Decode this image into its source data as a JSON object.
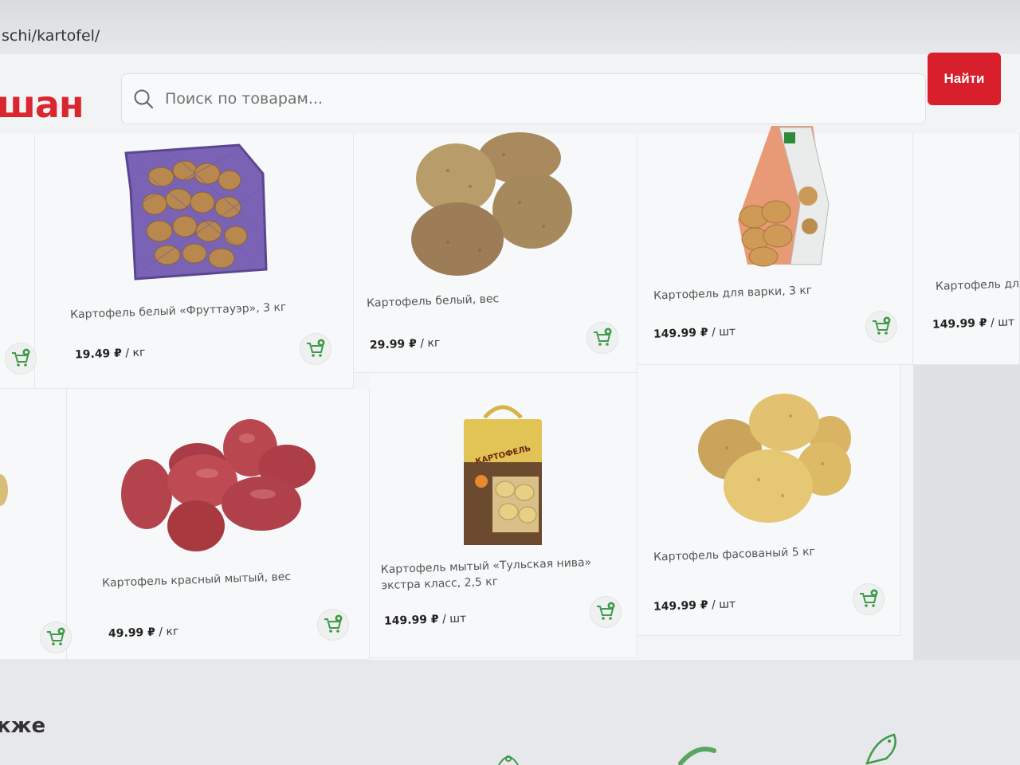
{
  "browser": {
    "url": "schi/kartofel/"
  },
  "header": {
    "logo_text": "шан",
    "search_placeholder": "Поиск по товарам...",
    "find_label": "Найти"
  },
  "products": [
    {
      "name": "Картофель белый «Фруттауэр», 3 кг",
      "price": "19.49 ₽",
      "unit": " / кг"
    },
    {
      "name": "Картофель белый, вес",
      "price": "29.99 ₽",
      "unit": " / кг"
    },
    {
      "name": "Картофель для варки, 3 кг",
      "price": "149.99 ₽",
      "unit": " / шт"
    },
    {
      "name": "Картофель для",
      "price": "149.99 ₽",
      "unit": " / шт"
    },
    {
      "name": "Картофель красный мытый, вес",
      "price": "49.99 ₽",
      "unit": " / кг"
    },
    {
      "name": "Картофель мытый «Тульская нива» экстра класс, 2,5 кг",
      "price": "149.99 ₽",
      "unit": " / шт"
    },
    {
      "name": "Картофель фасованый 5 кг",
      "price": "149.99 ₽",
      "unit": " / шт"
    }
  ],
  "bag_label": "КАРТОФЕЛЬ",
  "section": {
    "also_title": "кже"
  },
  "colors": {
    "brand_red": "#d8202d",
    "cart_green": "#3f9a4a",
    "potato": "#c9a463"
  },
  "icons": [
    "search-icon",
    "cart-add-icon",
    "cake-icon",
    "sausage-icon",
    "fish-icon"
  ]
}
